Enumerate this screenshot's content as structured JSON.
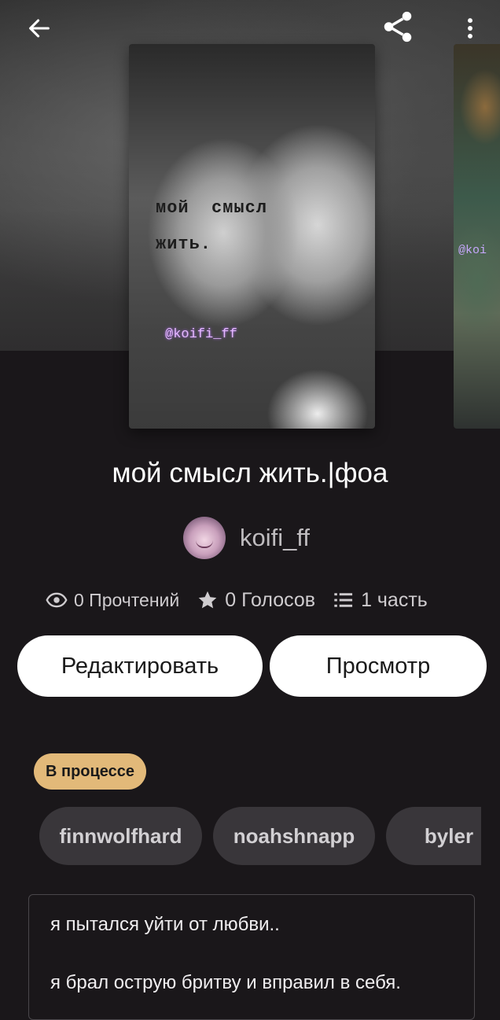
{
  "cover": {
    "line1": "мой  смысл",
    "line2": "жить.",
    "handle": "@koifi_ff"
  },
  "next_cover": {
    "handle": "@koi"
  },
  "story": {
    "title": "мой смысл жить.|фоа",
    "author": "koifi_ff",
    "reads": "0 Прочтений",
    "votes": "0 Голосов",
    "parts": "1 часть",
    "status": "В процессе"
  },
  "actions": {
    "edit_label": "Редактировать",
    "view_label": "Просмотр"
  },
  "tags": [
    "finnwolfhard",
    "noahshnapp",
    "byler"
  ],
  "description": [
    "я пытался уйти от любви..",
    "я брал острую бритву и вправил в себя."
  ],
  "icons": {
    "back": "arrow-left-icon",
    "share": "share-icon",
    "more": "more-vertical-icon",
    "reads": "eye-icon",
    "votes": "star-icon",
    "parts": "list-icon"
  },
  "colors": {
    "background": "#1a171a",
    "status_badge": "#e2b979",
    "tag_background": "#39363a",
    "button_background": "#ffffff"
  }
}
